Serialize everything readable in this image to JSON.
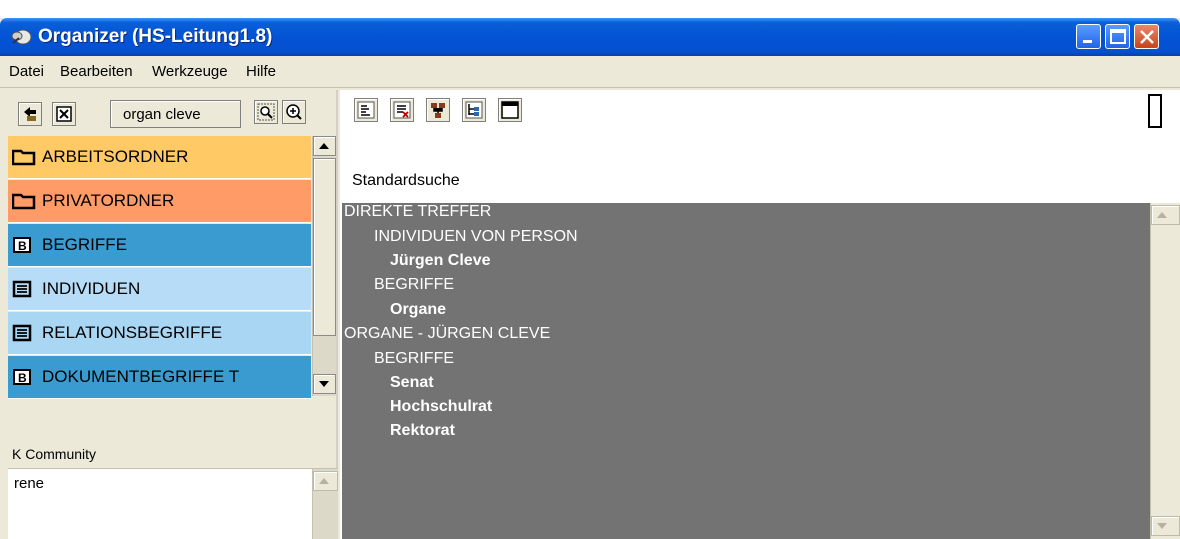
{
  "window": {
    "title": "Organizer (HS-Leitung1.8)"
  },
  "menu": [
    "Datei",
    "Bearbeiten",
    "Werkzeuge",
    "Hilfe"
  ],
  "left_toolbar": {
    "search_text": "organ cleve"
  },
  "folders": [
    {
      "label": "ARBEITSORDNER",
      "color": "#ffc966",
      "icon": "folder-icon"
    },
    {
      "label": "PRIVATORDNER",
      "color": "#ff9b66",
      "icon": "folder-icon"
    },
    {
      "label": "BEGRIFFE",
      "color": "#3a9bd0",
      "icon": "b-box-icon"
    },
    {
      "label": "INDIVIDUEN",
      "color": "#b7dcf7",
      "icon": "list-box-icon"
    },
    {
      "label": "RELATIONSBEGRIFFE",
      "color": "#a9d6f2",
      "icon": "list-box-icon"
    },
    {
      "label": "DOKUMENTBEGRIFFE T",
      "color": "#3a9bd0",
      "icon": "b-box-icon"
    }
  ],
  "community": {
    "label": "K Community",
    "items": [
      "rene"
    ]
  },
  "right_pane": {
    "search_mode_label": "Standardsuche",
    "results": [
      {
        "text": "DIREKTE TREFFER",
        "level": 0,
        "bold": false
      },
      {
        "text": "INDIVIDUEN VON  PERSON",
        "level": 1,
        "bold": false
      },
      {
        "text": "Jürgen Cleve",
        "level": 2,
        "bold": true
      },
      {
        "text": "BEGRIFFE",
        "level": 1,
        "bold": false
      },
      {
        "text": "Organe",
        "level": 2,
        "bold": true
      },
      {
        "text": "ORGANE - JÜRGEN CLEVE",
        "level": 0,
        "bold": false
      },
      {
        "text": "BEGRIFFE",
        "level": 1,
        "bold": false
      },
      {
        "text": "Senat",
        "level": 2,
        "bold": true
      },
      {
        "text": "Hochschulrat",
        "level": 2,
        "bold": true
      },
      {
        "text": "Rektorat",
        "level": 2,
        "bold": true
      }
    ]
  }
}
